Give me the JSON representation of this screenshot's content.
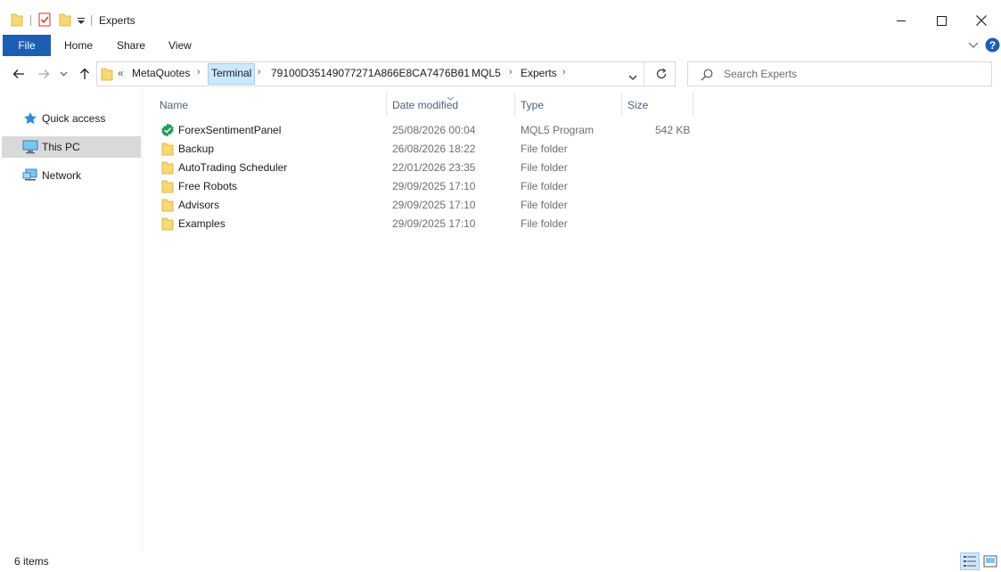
{
  "window": {
    "title": "Experts"
  },
  "ribbon": {
    "tabs": [
      "File",
      "Home",
      "Share",
      "View"
    ]
  },
  "address": {
    "overflow": "«",
    "crumbs": [
      "MetaQuotes",
      "Terminal",
      "79100D35149077271A866E8CA7476B61",
      "MQL5",
      "Experts"
    ]
  },
  "search": {
    "placeholder": "Search Experts"
  },
  "nav": {
    "items": [
      "Quick access",
      "This PC",
      "Network"
    ]
  },
  "columns": {
    "name": "Name",
    "date": "Date modified",
    "type": "Type",
    "size": "Size"
  },
  "files": [
    {
      "name": "ForexSentimentPanel",
      "date": "25/08/2026 00:04",
      "type": "MQL5 Program",
      "size": "542 KB",
      "icon": "mql5-program-icon"
    },
    {
      "name": "Backup",
      "date": "26/08/2026 18:22",
      "type": "File folder",
      "size": "",
      "icon": "folder-icon"
    },
    {
      "name": "AutoTrading Scheduler",
      "date": "22/01/2026 23:35",
      "type": "File folder",
      "size": "",
      "icon": "folder-icon"
    },
    {
      "name": "Free Robots",
      "date": "29/09/2025 17:10",
      "type": "File folder",
      "size": "",
      "icon": "folder-icon"
    },
    {
      "name": "Advisors",
      "date": "29/09/2025 17:10",
      "type": "File folder",
      "size": "",
      "icon": "folder-icon"
    },
    {
      "name": "Examples",
      "date": "29/09/2025 17:10",
      "type": "File folder",
      "size": "",
      "icon": "folder-icon"
    }
  ],
  "status": {
    "count": "6 items"
  },
  "colors": {
    "accent": "#1a5fb4",
    "folder": "#f8d775",
    "highlight": "#cce8ff",
    "selected": "#d9d9d9"
  }
}
